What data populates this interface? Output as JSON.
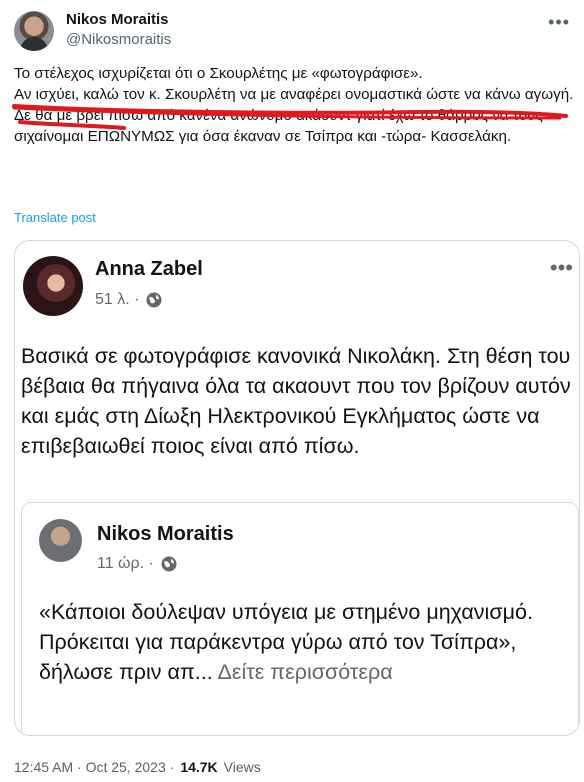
{
  "author": {
    "display_name": "Nikos Moraitis",
    "handle": "@Nikosmoraitis"
  },
  "tweet": {
    "paragraph1_line1": "Το στέλεχος ισχυρίζεται ότι ο Σκουρλέτης με «φωτογράφισε».",
    "paragraph1_line2": "Αν ισχύει, καλώ τον κ. Σκουρλέτη να με αναφέρει ονομαστικά ώστε να κάνω αγωγή.",
    "paragraph2": "Δε θα με βρει πίσω από κανένα ανώνυμο ακάουντ γιατί έχω το θάρρος να τους σιχαίνομαι ΕΠΩΝΥΜΩΣ για όσα έκαναν σε Τσίπρα και -τώρα- Κασσελάκη.",
    "translate_label": "Translate post"
  },
  "embedded_post": {
    "author": "Anna Zabel",
    "time": "51 λ. ·",
    "text": "Βασικά σε φωτογράφισε κανονικά Νικολάκη. Στη θέση του βέβαια θα πήγαινα όλα τα ακαουντ που τον βρίζουν αυτόν και εμάς στη Δίωξη Ηλεκτρονικού Εγκλήματος ώστε να επιβεβαιωθεί ποιος είναι από πίσω.",
    "shared_post": {
      "author": "Nikos Moraitis",
      "time": "11 ώρ. ·",
      "text": "«Κάποιοι δούλεψαν υπόγεια με στημένο μηχανισμό. Πρόκειται για παράκεντρα γύρω από τον Τσίπρα», δήλωσε πριν απ...",
      "see_more": "Δείτε περισσότερα"
    }
  },
  "footer": {
    "timestamp": "12:45 AM · Oct 25, 2023 ·",
    "views_count": "14.7K",
    "views_label": "Views"
  },
  "icons": {
    "more": "more-dots-icon",
    "globe": "globe-icon"
  },
  "colors": {
    "link": "#1d9bf0",
    "annotation_red": "#e0191d"
  }
}
